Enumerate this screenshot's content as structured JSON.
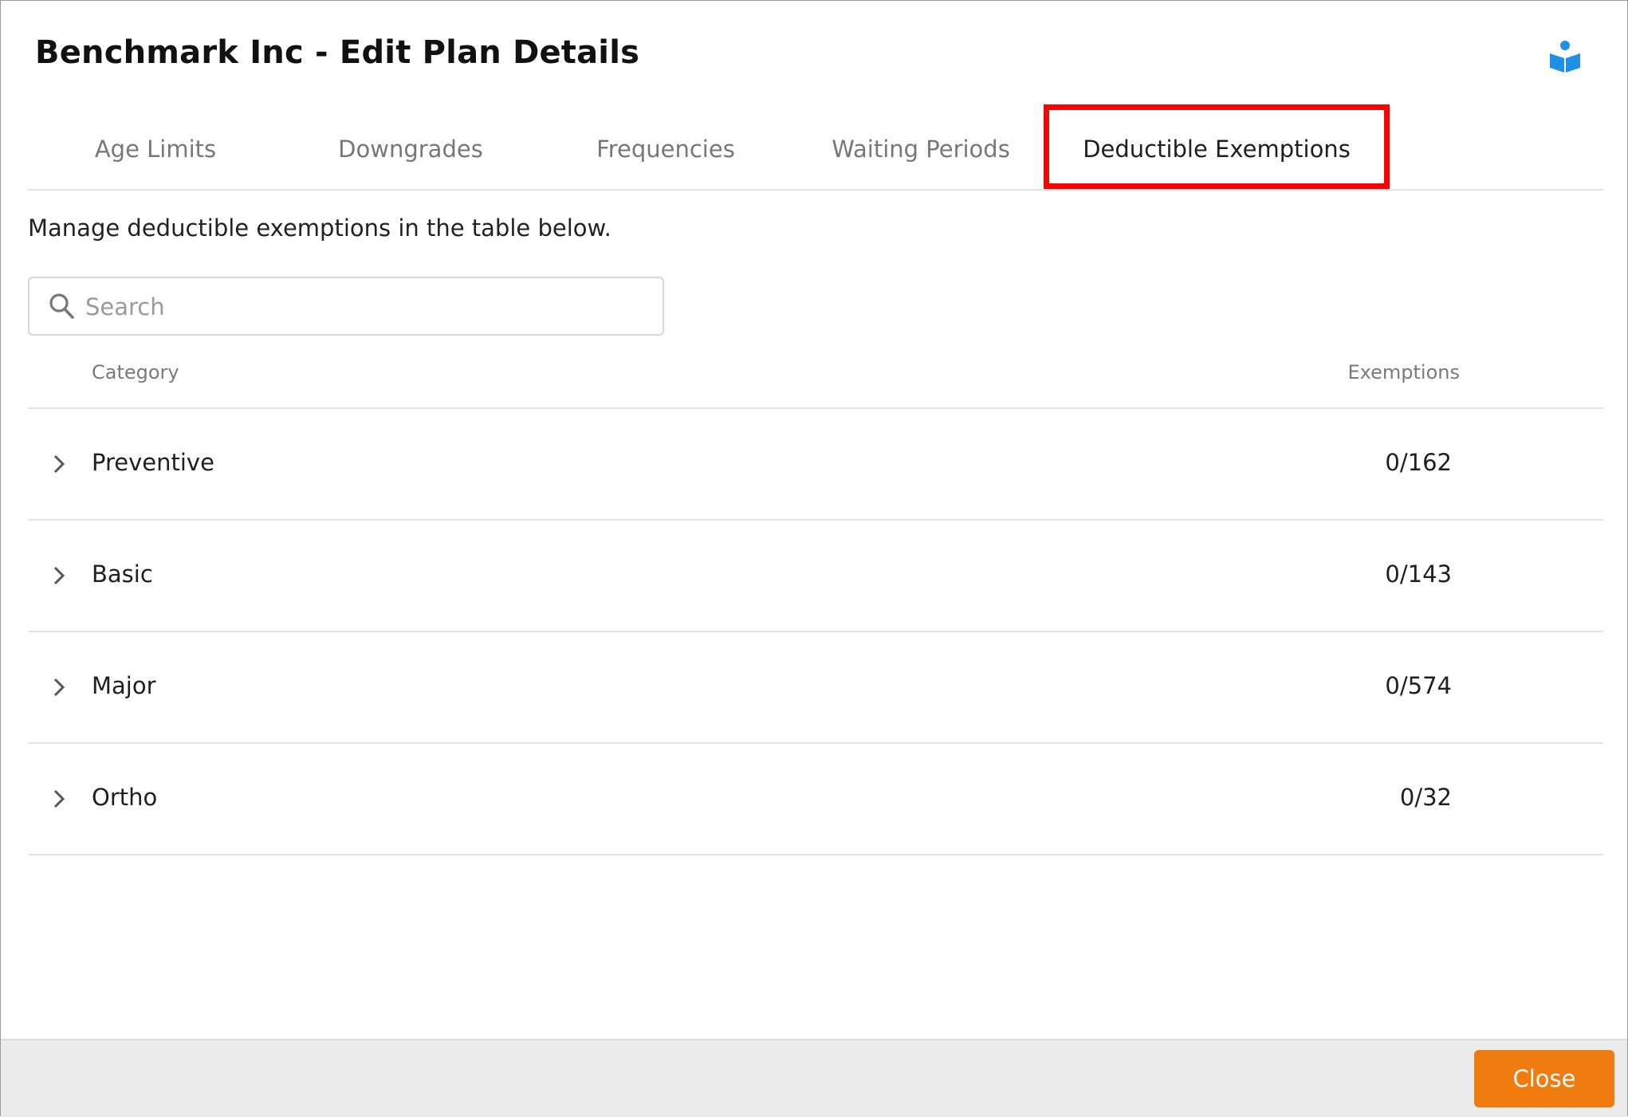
{
  "dialog": {
    "title": "Benchmark Inc - Edit Plan Details",
    "help_icon": "book-reader-icon",
    "accent_color": "#1e90e6"
  },
  "tabs": [
    {
      "label": "Age Limits",
      "active": false
    },
    {
      "label": "Downgrades",
      "active": false
    },
    {
      "label": "Frequencies",
      "active": false
    },
    {
      "label": "Waiting Periods",
      "active": false
    },
    {
      "label": "Deductible Exemptions",
      "active": true
    }
  ],
  "highlight_color": "#ff0000",
  "intro_text": "Manage deductible exemptions in the table below.",
  "search": {
    "placeholder": "Search",
    "value": "",
    "icon": "search-icon"
  },
  "table": {
    "headers": {
      "category": "Category",
      "exemptions": "Exemptions"
    },
    "rows": [
      {
        "category": "Preventive",
        "exemptions": "0/162"
      },
      {
        "category": "Basic",
        "exemptions": "0/143"
      },
      {
        "category": "Major",
        "exemptions": "0/574"
      },
      {
        "category": "Ortho",
        "exemptions": "0/32"
      }
    ]
  },
  "footer": {
    "close_label": "Close",
    "close_color": "#f07c10"
  }
}
